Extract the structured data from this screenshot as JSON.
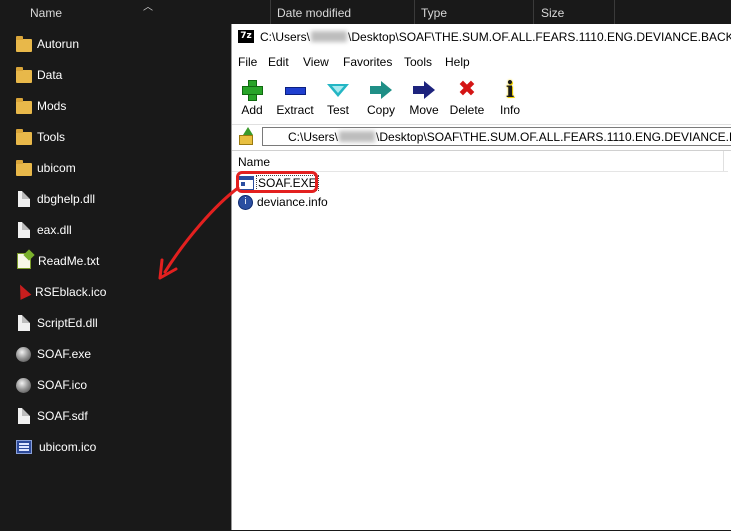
{
  "explorer": {
    "columns": [
      "Name",
      "Date modified",
      "Type",
      "Size"
    ],
    "items": [
      {
        "name": "Autorun",
        "icon": "folder-icon"
      },
      {
        "name": "Data",
        "icon": "folder-icon"
      },
      {
        "name": "Mods",
        "icon": "folder-icon"
      },
      {
        "name": "Tools",
        "icon": "folder-icon"
      },
      {
        "name": "ubicom",
        "icon": "folder-icon"
      },
      {
        "name": "dbghelp.dll",
        "icon": "dll-file-icon"
      },
      {
        "name": "eax.dll",
        "icon": "dll-file-icon"
      },
      {
        "name": "ReadMe.txt",
        "icon": "notepad-file-icon"
      },
      {
        "name": "RSEblack.ico",
        "icon": "red-logo-icon"
      },
      {
        "name": "ScriptEd.dll",
        "icon": "dll-file-icon"
      },
      {
        "name": "SOAF.exe",
        "icon": "globe-icon"
      },
      {
        "name": "SOAF.ico",
        "icon": "globe-icon"
      },
      {
        "name": "SOAF.sdf",
        "icon": "blank-file-icon"
      },
      {
        "name": "ubicom.ico",
        "icon": "ubicom-logo-icon"
      }
    ]
  },
  "zip": {
    "app_icon_text": "7z",
    "title_prefix": "C:\\Users\\",
    "title_suffix": "\\Desktop\\SOAF\\THE.SUM.OF.ALL.FEARS.1110.ENG.DEVIANCE.BACKUPCD.Z",
    "menu": [
      "File",
      "Edit",
      "View",
      "Favorites",
      "Tools",
      "Help"
    ],
    "toolbar": [
      {
        "label": "Add",
        "icon": "add-plus-icon"
      },
      {
        "label": "Extract",
        "icon": "extract-minus-icon"
      },
      {
        "label": "Test",
        "icon": "test-check-icon"
      },
      {
        "label": "Copy",
        "icon": "copy-arrow-icon"
      },
      {
        "label": "Move",
        "icon": "move-arrow-icon"
      },
      {
        "label": "Delete",
        "icon": "delete-x-icon"
      },
      {
        "label": "Info",
        "icon": "info-icon"
      }
    ],
    "toolbar_glyphs": {
      "delete": "✖",
      "info": "i"
    },
    "address_prefix": "C:\\Users\\",
    "address_suffix": "\\Desktop\\SOAF\\THE.SUM.OF.ALL.FEARS.1110.ENG.DEVIANCE.BACKU",
    "list_header": "Name",
    "files": [
      {
        "name": "SOAF.EXE",
        "icon": "exe-file-icon",
        "selected": true
      },
      {
        "name": "deviance.info",
        "icon": "info-file-icon",
        "selected": false
      }
    ],
    "info_glyph": "i"
  },
  "annotation": {
    "color": "#e3201f"
  }
}
